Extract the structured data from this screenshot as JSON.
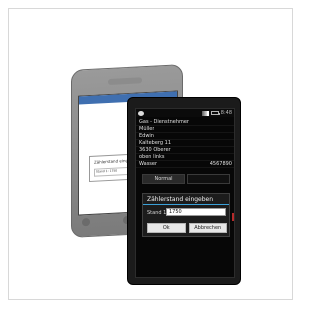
{
  "back_phone": {
    "dialog_title": "Zählerstand eingeben",
    "input_label": "Stand 1:",
    "input_value": "1750"
  },
  "front_phone": {
    "status_time": "8:48",
    "list_items": [
      {
        "left": "Gas - Dienstnehmer",
        "right": ""
      },
      {
        "left": "Müller",
        "right": ""
      },
      {
        "left": "Edwin",
        "right": ""
      },
      {
        "left": "Kalteberg 11",
        "right": ""
      },
      {
        "left": "3630 Oberer",
        "right": ""
      },
      {
        "left": "oben links",
        "right": ""
      },
      {
        "left": "Wasser",
        "right": "4567890"
      }
    ],
    "segment": {
      "left": "Normal",
      "right": ""
    },
    "dialog": {
      "title": "Zählerstand eingeben",
      "label": "Stand 1:",
      "input_value": "1750",
      "ok_label": "Ok",
      "cancel_label": "Abbrechen"
    }
  }
}
